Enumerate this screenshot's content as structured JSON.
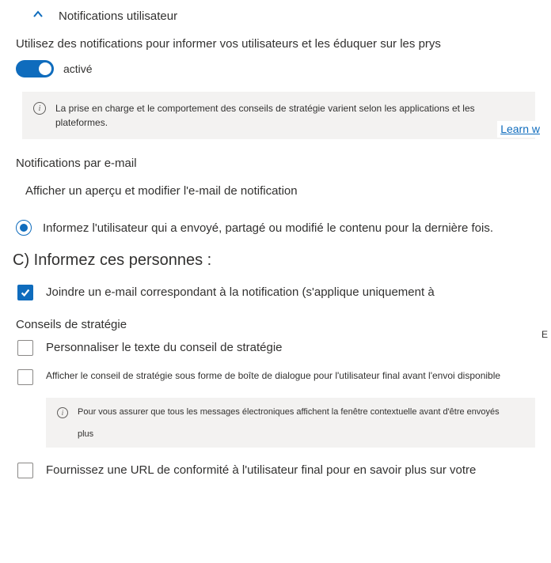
{
  "header": {
    "title": "Notifications utilisateur"
  },
  "description": "Utilisez des notifications pour informer vos utilisateurs et les éduquer sur les prys",
  "toggle": {
    "state_label": "activé"
  },
  "banner1": {
    "text": "La prise en charge et le comportement des conseils de stratégie varient selon les applications et les plateformes.",
    "learn_link": "Learn w"
  },
  "email_section": {
    "heading": "Notifications par e-mail",
    "preview_action": "Afficher un aperçu et modifier l'e-mail de notification"
  },
  "radio": {
    "notify_sender_label": "Informez l'utilisateur qui a envoyé, partagé ou modifié le contenu pour la dernière fois."
  },
  "option_c_heading": "C) Informez ces personnes :",
  "checkboxes": {
    "attach_email_label": "Joindre un e-mail correspondant à la notification (s'applique uniquement à"
  },
  "tips_section": {
    "heading": "Conseils de stratégie",
    "customize_text_label": "Personnaliser le texte du conseil de stratégie",
    "dialog_label": "Afficher le conseil de stratégie sous forme de boîte de dialogue pour l'utilisateur final avant l'envoi disponible",
    "dialog_banner_text": "Pour vous assurer que tous les messages électroniques affichent la fenêtre contextuelle avant d'être envoyés",
    "dialog_banner_more": "plus",
    "compliance_url_label": "Fournissez une URL de conformité à l'utilisateur final pour en savoir plus sur votre"
  },
  "truncation_e": "E"
}
